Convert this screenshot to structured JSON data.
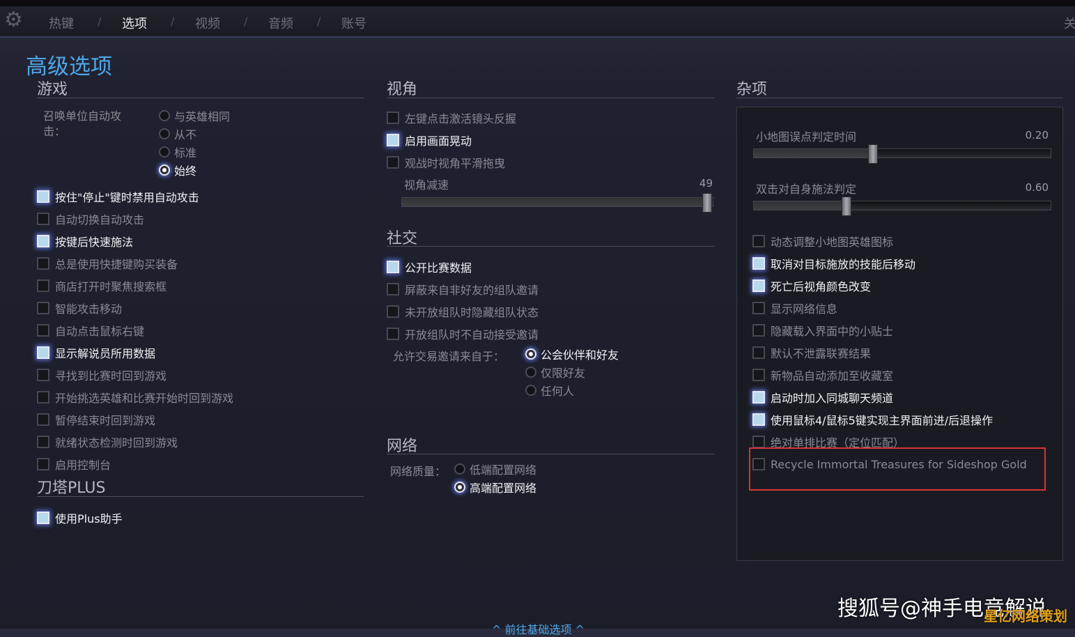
{
  "nav": {
    "tabs": [
      "热键",
      "选项",
      "视频",
      "音频",
      "账号"
    ],
    "separator": "/",
    "active_index": 1,
    "close_char": "关"
  },
  "page_title": "高级选项",
  "game": {
    "title": "游戏",
    "summon_label": "召唤单位自动攻击：",
    "summon_options": [
      {
        "label": "与英雄相同",
        "selected": false
      },
      {
        "label": "从不",
        "selected": false
      },
      {
        "label": "标准",
        "selected": false
      },
      {
        "label": "始终",
        "selected": true
      }
    ],
    "checkboxes": [
      {
        "label": "按住\"停止\"键时禁用自动攻击",
        "checked": true
      },
      {
        "label": "自动切换自动攻击",
        "checked": false
      },
      {
        "label": "按键后快速施法",
        "checked": true
      },
      {
        "label": "总是使用快捷键购买装备",
        "checked": false
      },
      {
        "label": "商店打开时聚焦搜索框",
        "checked": false
      },
      {
        "label": "智能攻击移动",
        "checked": false
      },
      {
        "label": "自动点击鼠标右键",
        "checked": false
      },
      {
        "label": "显示解说员所用数据",
        "checked": true
      },
      {
        "label": "寻找到比赛时回到游戏",
        "checked": false
      },
      {
        "label": "开始挑选英雄和比赛开始时回到游戏",
        "checked": false
      },
      {
        "label": "暂停结束时回到游戏",
        "checked": false
      },
      {
        "label": "就绪状态检测时回到游戏",
        "checked": false
      },
      {
        "label": "启用控制台",
        "checked": false
      }
    ]
  },
  "plus": {
    "title": "刀塔PLUS",
    "checkboxes": [
      {
        "label": "使用Plus助手",
        "checked": true
      }
    ]
  },
  "camera": {
    "title": "视角",
    "checkboxes": [
      {
        "label": "左键点击激活镜头反握",
        "checked": false
      },
      {
        "label": "启用画面晃动",
        "checked": true
      },
      {
        "label": "观战时视角平滑拖曳",
        "checked": false
      }
    ],
    "slider": {
      "label": "视角减速",
      "value": "49",
      "fraction": 0.98
    }
  },
  "social": {
    "title": "社交",
    "checkboxes": [
      {
        "label": "公开比赛数据",
        "checked": true
      },
      {
        "label": "屏蔽来自非好友的组队邀请",
        "checked": false
      },
      {
        "label": "未开放组队时隐藏组队状态",
        "checked": false
      },
      {
        "label": "开放组队时不自动接受邀请",
        "checked": false
      }
    ],
    "trade_label": "允许交易邀请来自于：",
    "trade_options": [
      {
        "label": "公会伙伴和好友",
        "selected": true
      },
      {
        "label": "仅限好友",
        "selected": false
      },
      {
        "label": "任何人",
        "selected": false
      }
    ]
  },
  "network": {
    "title": "网络",
    "quality_label": "网络质量：",
    "quality_options": [
      {
        "label": "低端配置网络",
        "selected": false
      },
      {
        "label": "高端配置网络",
        "selected": true
      }
    ]
  },
  "misc": {
    "title": "杂项",
    "sliders": [
      {
        "label": "小地图误点判定时间",
        "value": "0.20",
        "fraction": 0.4
      },
      {
        "label": "双击对自身施法判定",
        "value": "0.60",
        "fraction": 0.31
      }
    ],
    "checkboxes": [
      {
        "label": "动态调整小地图英雄图标",
        "checked": false
      },
      {
        "label": "取消对目标施放的技能后移动",
        "checked": true
      },
      {
        "label": "死亡后视角颜色改变",
        "checked": true
      },
      {
        "label": "显示网络信息",
        "checked": false
      },
      {
        "label": "隐藏载入界面中的小贴士",
        "checked": false
      },
      {
        "label": "默认不泄露联赛结果",
        "checked": false
      },
      {
        "label": "新物品自动添加至收藏室",
        "checked": false
      },
      {
        "label": "启动时加入同城聊天频道",
        "checked": true
      },
      {
        "label": "使用鼠标4/鼠标5键实现主界面前进/后退操作",
        "checked": true
      },
      {
        "label": "绝对单排比赛（定位匹配）",
        "checked": false
      },
      {
        "label": "Recycle Immortal Treasures for Sideshop Gold",
        "checked": false
      }
    ]
  },
  "highlight_color": "#d63434",
  "accent_color": "#4ea7e6",
  "bottom_link": "^ 前往基础选项 ^",
  "watermark": {
    "primary": "搜狐号@神手电竞解说",
    "secondary": "星亿网络策划"
  }
}
